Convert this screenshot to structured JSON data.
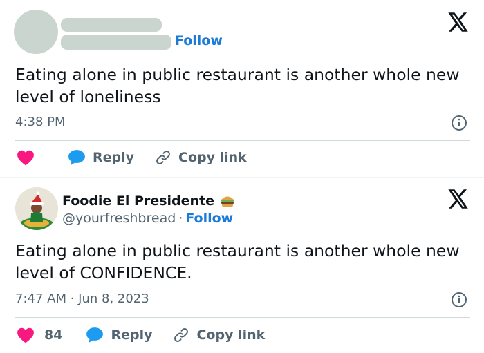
{
  "tweets": [
    {
      "follow_label": "Follow",
      "text": "Eating alone in public restaurant is another whole new level of loneliness",
      "time": "4:38 PM",
      "actions": {
        "like_count": "",
        "reply_label": "Reply",
        "copy_label": "Copy link"
      }
    },
    {
      "display_name": "Foodie El Presidente",
      "handle": "@yourfreshbread",
      "separator": "·",
      "follow_label": "Follow",
      "text": "Eating alone in public restaurant is another whole new level of CONFIDENCE.",
      "time": "7:47 AM · Jun 8, 2023",
      "actions": {
        "like_count": "84",
        "reply_label": "Reply",
        "copy_label": "Copy link"
      }
    }
  ],
  "icons": {
    "logo": "x-logo-icon",
    "info": "info-icon",
    "like": "heart-icon",
    "reply": "speech-bubble-icon",
    "copy": "link-icon",
    "badge": "hamburger-emoji-icon"
  },
  "colors": {
    "accent": "#1d7bd8",
    "heart": "#f91880",
    "reply_bubble": "#1d9bf0",
    "muted_text": "#536471",
    "redacted": "#cbd5cf"
  }
}
